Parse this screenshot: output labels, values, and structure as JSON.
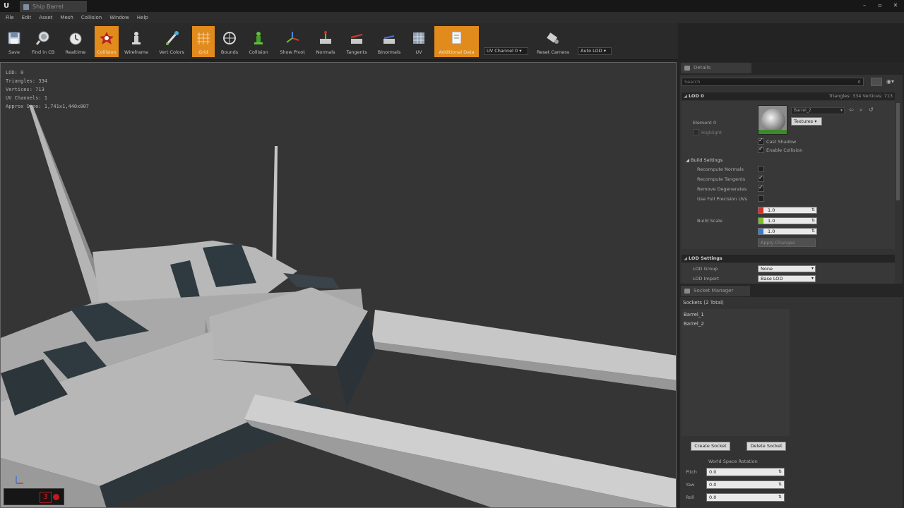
{
  "window": {
    "tab_title": "Ship Barrel",
    "controls": [
      "minimize-icon",
      "restore-icon",
      "close-icon"
    ]
  },
  "menu": [
    "File",
    "Edit",
    "Asset",
    "Mesh",
    "Collision",
    "Window",
    "Help"
  ],
  "toolbar": {
    "buttons": [
      {
        "label": "Save",
        "icon": "save-icon",
        "active": false
      },
      {
        "label": "Find in CB",
        "icon": "find-in-content-browser-icon",
        "active": false
      },
      {
        "label": "Realtime",
        "icon": "realtime-icon",
        "active": false
      },
      {
        "label": "Collision",
        "icon": "collision-icon",
        "active": true
      },
      {
        "label": "Wireframe",
        "icon": "wireframe-icon",
        "active": false
      },
      {
        "label": "Vert Colors",
        "icon": "vertex-colors-icon",
        "active": false
      },
      {
        "label": "Grid",
        "icon": "grid-icon",
        "active": true
      },
      {
        "label": "Bounds",
        "icon": "bounds-icon",
        "active": false
      },
      {
        "label": "Collision",
        "icon": "simple-collision-icon",
        "active": false
      },
      {
        "label": "Show Pivot",
        "icon": "show-pivot-icon",
        "active": false
      },
      {
        "label": "Normals",
        "icon": "normals-icon",
        "active": false
      },
      {
        "label": "Tangents",
        "icon": "tangents-icon",
        "active": false
      },
      {
        "label": "Binormals",
        "icon": "binormals-icon",
        "active": false
      },
      {
        "label": "UV",
        "icon": "uv-icon",
        "active": false
      },
      {
        "label": "Additional Data",
        "icon": "additional-data-icon",
        "active": true
      },
      {
        "label": "Reset Camera",
        "icon": "reset-camera-icon",
        "active": false
      }
    ],
    "uv_channel": "UV Channel 0",
    "auto_lod": "Auto LOD"
  },
  "viewport": {
    "stats": [
      "LOD:  0",
      "Triangles:  334",
      "Vertices:  713",
      "UV Channels:  1",
      "Approx Size: 1,741x1,440x807"
    ],
    "recorder_value": "3"
  },
  "details": {
    "tab_label": "Details",
    "search_placeholder": "Search",
    "lod": {
      "title": "LOD 0",
      "stats": "Triangles: 334    Vertices: 713",
      "element_label": "Element 0",
      "highlight_label": "Highlight",
      "material_name": "Barrel_2",
      "textures_label": "Textures",
      "cast_shadow": "Cast Shadow",
      "enable_collision": "Enable Collision",
      "build_settings_title": "Build Settings",
      "build_rows": [
        {
          "label": "Recompute Normals",
          "checked": false
        },
        {
          "label": "Recompute Tangents",
          "checked": true
        },
        {
          "label": "Remove Degenerates",
          "checked": true
        },
        {
          "label": "Use Full Precision UVs",
          "checked": false
        }
      ],
      "build_scale_label": "Build Scale",
      "build_scale": [
        "1.0",
        "1.0",
        "1.0"
      ],
      "apply_label": "Apply Changes"
    },
    "lod_settings": {
      "title": "LOD Settings",
      "rows": [
        {
          "label": "LOD Group",
          "value": "None"
        },
        {
          "label": "LOD Import",
          "value": "Base LOD"
        }
      ]
    }
  },
  "sockets": {
    "tab_label": "Socket Manager",
    "header": "Sockets (2 Total)",
    "items": [
      "Barrel_1",
      "Barrel_2"
    ],
    "create_label": "Create Socket",
    "delete_label": "Delete Socket",
    "rotation_title": "World Space Rotation",
    "rotation": [
      {
        "label": "Pitch",
        "value": "0.0"
      },
      {
        "label": "Yaw",
        "value": "0.0"
      },
      {
        "label": "Roll",
        "value": "0.0"
      }
    ]
  },
  "colors": {
    "accent": "#e28b1d",
    "axis_x": "#d4322c",
    "axis_y": "#7bbf2a",
    "axis_z": "#3c7bd5",
    "record": "#c8181b"
  }
}
